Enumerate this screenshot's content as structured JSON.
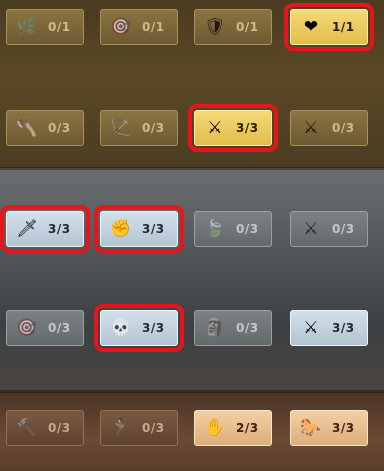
{
  "bands": [
    {
      "name": "gold",
      "rows": [
        [
          {
            "icon": "leaf-bundle-icon",
            "glyph": "🌿",
            "count": "0/1",
            "active": false,
            "highlighted": false
          },
          {
            "icon": "target-soldier-icon",
            "glyph": "🎯",
            "count": "0/1",
            "active": false,
            "highlighted": false
          },
          {
            "icon": "shield-plus-icon",
            "glyph": "🛡",
            "count": "0/1",
            "active": false,
            "highlighted": false
          },
          {
            "icon": "winged-heart-icon",
            "glyph": "❤",
            "count": "1/1",
            "active": true,
            "highlighted": true
          }
        ],
        [
          {
            "icon": "axe-icon",
            "glyph": "🪓",
            "count": "0/3",
            "active": false,
            "highlighted": false
          },
          {
            "icon": "ballista-icon",
            "glyph": "🏹",
            "count": "0/3",
            "active": false,
            "highlighted": false
          },
          {
            "icon": "crossed-swords-troops-icon",
            "glyph": "⚔",
            "count": "3/3",
            "active": true,
            "highlighted": true
          },
          {
            "icon": "crossed-swords-timer-icon",
            "glyph": "⚔",
            "count": "0/3",
            "active": false,
            "highlighted": false
          }
        ]
      ]
    },
    {
      "name": "grey",
      "rows": [
        [
          {
            "icon": "spear-tip-icon",
            "glyph": "🗡",
            "count": "3/3",
            "active": true,
            "highlighted": true
          },
          {
            "icon": "raised-fist-icon",
            "glyph": "✊",
            "count": "3/3",
            "active": true,
            "highlighted": true
          },
          {
            "icon": "leaf-plus-icon",
            "glyph": "🍃",
            "count": "0/3",
            "active": false,
            "highlighted": false
          },
          {
            "icon": "crossed-swords-plus-icon",
            "glyph": "⚔",
            "count": "0/3",
            "active": false,
            "highlighted": false
          }
        ],
        [
          {
            "icon": "arrow-volley-icon",
            "glyph": "🎯",
            "count": "0/3",
            "active": false,
            "highlighted": false
          },
          {
            "icon": "skull-heart-icon",
            "glyph": "💀",
            "count": "3/3",
            "active": true,
            "highlighted": true
          },
          {
            "icon": "bust-plus-icon",
            "glyph": "🗿",
            "count": "0/3",
            "active": false,
            "highlighted": false
          },
          {
            "icon": "crossed-swords-flask-icon",
            "glyph": "⚔",
            "count": "3/3",
            "active": true,
            "highlighted": false
          }
        ]
      ]
    },
    {
      "name": "brown",
      "rows": [
        [
          {
            "icon": "siege-hammer-icon",
            "glyph": "🔨",
            "count": "0/3",
            "active": false,
            "highlighted": false
          },
          {
            "icon": "running-figure-icon",
            "glyph": "🏃",
            "count": "0/3",
            "active": false,
            "highlighted": false
          },
          {
            "icon": "healing-hand-icon",
            "glyph": "✋",
            "count": "2/3",
            "active": true,
            "highlighted": false
          },
          {
            "icon": "war-horse-icon",
            "glyph": "🐎",
            "count": "3/3",
            "active": true,
            "highlighted": false
          }
        ]
      ]
    }
  ]
}
